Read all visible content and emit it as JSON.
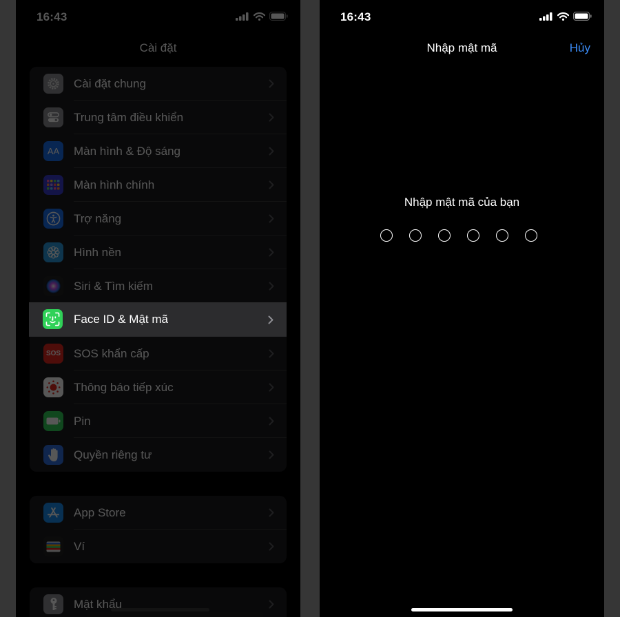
{
  "left_screen": {
    "status_time": "16:43",
    "nav_title": "Cài đặt",
    "group1": [
      {
        "label": "Cài đặt chung",
        "icon": "gear-icon",
        "color": "#8e8e93"
      },
      {
        "label": "Trung tâm điều khiển",
        "icon": "toggles-icon",
        "color": "#8e8e93"
      },
      {
        "label": "Màn hình & Độ sáng",
        "icon": "text-size-icon",
        "color": "#1a6ff0",
        "glyph": "AA"
      },
      {
        "label": "Màn hình chính",
        "icon": "home-grid-icon",
        "color": "#3a3ccf"
      },
      {
        "label": "Trợ năng",
        "icon": "accessibility-icon",
        "color": "#1a6ff0"
      },
      {
        "label": "Hình nền",
        "icon": "wallpaper-icon",
        "color": "#2a9be0"
      },
      {
        "label": "Siri & Tìm kiếm",
        "icon": "siri-icon",
        "color": "#222222"
      }
    ],
    "selected": {
      "label": "Face ID & Mật mã",
      "icon": "face-id-icon",
      "color": "#30d158"
    },
    "group1b": [
      {
        "label": "SOS khẩn cấp",
        "icon": "sos-icon",
        "color": "#e3261f",
        "glyph": "SOS"
      },
      {
        "label": "Thông báo tiếp xúc",
        "icon": "exposure-notification-icon",
        "color": "#ffffff"
      },
      {
        "label": "Pin",
        "icon": "battery-icon",
        "color": "#30d158"
      },
      {
        "label": "Quyền riêng tư",
        "icon": "hand-icon",
        "color": "#2f6fe0"
      }
    ],
    "group2": [
      {
        "label": "App Store",
        "icon": "app-store-icon",
        "color": "#1a8cf0"
      },
      {
        "label": "Ví",
        "icon": "wallet-icon",
        "color": "#222222"
      }
    ],
    "group3": [
      {
        "label": "Mật khẩu",
        "icon": "key-icon",
        "color": "#8e8e93"
      }
    ]
  },
  "right_screen": {
    "status_time": "16:43",
    "nav_title": "Nhập mật mã",
    "cancel_label": "Hủy",
    "prompt": "Nhập mật mã của bạn",
    "passcode_length": 6,
    "entered_digits": 0
  }
}
